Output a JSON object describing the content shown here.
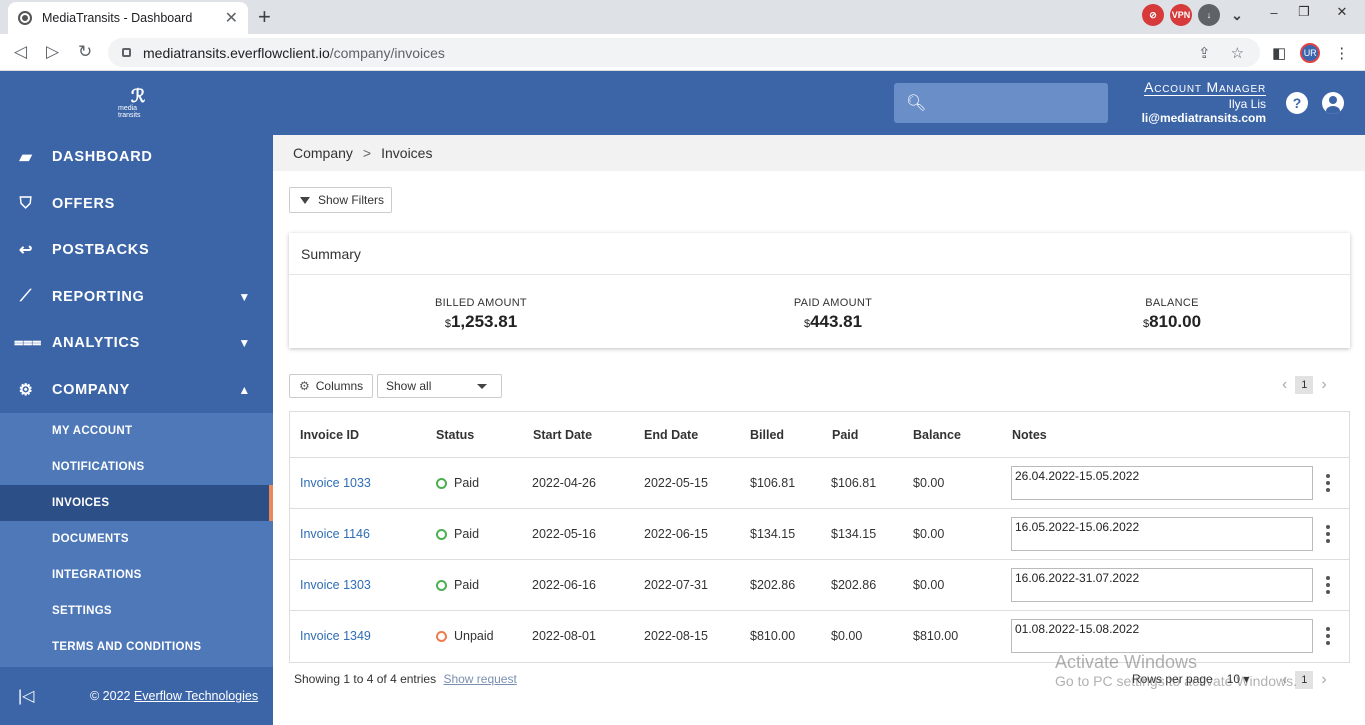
{
  "browser": {
    "tab_title": "MediaTransits - Dashboard",
    "tab_close": "✕",
    "new_tab": "+",
    "url_host": "mediatransits.everflowclient.io",
    "url_path": "/company/invoices",
    "ext_icons": [
      "ext-red-icon",
      "vpn-icon",
      "download-icon"
    ],
    "profile_initials": "UR"
  },
  "sidebar": {
    "logo_text": "media transits",
    "items": [
      {
        "label": "DASHBOARD",
        "icon": "dashboard-icon"
      },
      {
        "label": "OFFERS",
        "icon": "offers-icon"
      },
      {
        "label": "POSTBACKS",
        "icon": "postbacks-icon"
      },
      {
        "label": "REPORTING",
        "icon": "reporting-icon"
      },
      {
        "label": "ANALYTICS",
        "icon": "analytics-icon"
      },
      {
        "label": "COMPANY",
        "icon": "gear-icon"
      }
    ],
    "subitems": [
      {
        "label": "MY ACCOUNT"
      },
      {
        "label": "NOTIFICATIONS"
      },
      {
        "label": "INVOICES"
      },
      {
        "label": "DOCUMENTS"
      },
      {
        "label": "INTEGRATIONS"
      },
      {
        "label": "SETTINGS"
      },
      {
        "label": "TERMS AND CONDITIONS"
      }
    ],
    "footer_prefix": "© 2022 ",
    "footer_link": "Everflow Technologies"
  },
  "header": {
    "search_placeholder": "",
    "account_title": "Account Manager",
    "account_name": "Ilya Lis",
    "account_email": "li@mediatransits.com"
  },
  "breadcrumb": {
    "parent": "Company",
    "separator": ">",
    "current": "Invoices"
  },
  "filters_button": "Show Filters",
  "summary": {
    "title": "Summary",
    "metrics": [
      {
        "label": "BILLED AMOUNT",
        "currency": "$",
        "value": "1,253.81"
      },
      {
        "label": "PAID AMOUNT",
        "currency": "$",
        "value": "443.81"
      },
      {
        "label": "BALANCE",
        "currency": "$",
        "value": "810.00"
      }
    ]
  },
  "table_tools": {
    "columns_label": "Columns",
    "show_select": "Show all",
    "page": "1"
  },
  "table": {
    "headers": [
      "Invoice ID",
      "Status",
      "Start Date",
      "End Date",
      "Billed",
      "Paid",
      "Balance",
      "Notes"
    ],
    "rows": [
      {
        "id": "Invoice 1033",
        "status": "Paid",
        "start": "2022-04-26",
        "end": "2022-05-15",
        "billed": "$106.81",
        "paid": "$106.81",
        "balance": "$0.00",
        "notes": "26.04.2022-15.05.2022"
      },
      {
        "id": "Invoice 1146",
        "status": "Paid",
        "start": "2022-05-16",
        "end": "2022-06-15",
        "billed": "$134.15",
        "paid": "$134.15",
        "balance": "$0.00",
        "notes": "16.05.2022-15.06.2022"
      },
      {
        "id": "Invoice 1303",
        "status": "Paid",
        "start": "2022-06-16",
        "end": "2022-07-31",
        "billed": "$202.86",
        "paid": "$202.86",
        "balance": "$0.00",
        "notes": "16.06.2022-31.07.2022"
      },
      {
        "id": "Invoice 1349",
        "status": "Unpaid",
        "start": "2022-08-01",
        "end": "2022-08-15",
        "billed": "$810.00",
        "paid": "$0.00",
        "balance": "$810.00",
        "notes": "01.08.2022-15.08.2022"
      }
    ]
  },
  "footer": {
    "showing": "Showing 1 to 4 of 4 entries",
    "show_request": "Show request",
    "rows_per_page_label": "Rows per page",
    "rows_per_page_value": "10",
    "page": "1"
  },
  "overlay": {
    "activate_title": "Activate Windows",
    "activate_sub": "Go to PC settings to activate Windows."
  },
  "colors": {
    "brand_blue": "#3c65a8",
    "sub_blue": "#4e78b8",
    "active_accent": "#e98a57",
    "paid_green": "#4caf50",
    "unpaid_orange": "#f07a4a",
    "link_blue": "#2f6db5"
  }
}
